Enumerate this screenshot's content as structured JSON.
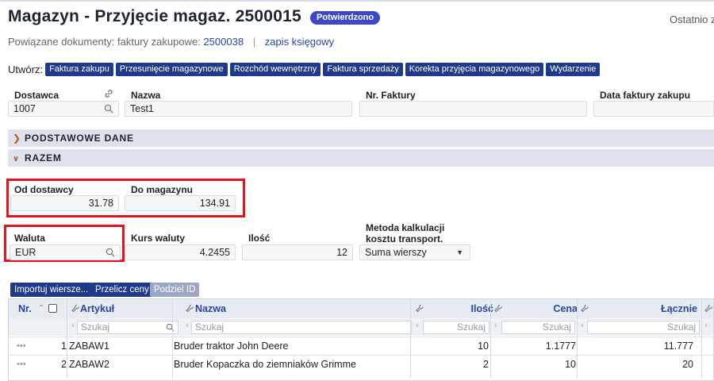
{
  "header": {
    "title": "Magazyn - Przyjęcie magaz. 2500015",
    "status_badge": "Potwierdzono",
    "last_changed": "Ostatnio z"
  },
  "related": {
    "label": "Powiązane dokumenty:",
    "invoices_label": "faktury zakupowe:",
    "invoice_link": "2500038",
    "separator": "|",
    "ledger_link": "zapis księgowy"
  },
  "create": {
    "label": "Utwórz:",
    "buttons": [
      "Faktura zakupu",
      "Przesunięcie magazynowe",
      "Rozchód wewnętrzny",
      "Faktura sprzedaży",
      "Korekta przyjęcia magazynowego",
      "Wydarzenie"
    ]
  },
  "supplier": {
    "supplier_label": "Dostawca",
    "supplier_value": "1007",
    "name_label": "Nazwa",
    "name_value": "Test1",
    "invoice_no_label": "Nr. Faktury",
    "invoice_no_value": "",
    "invoice_date_label": "Data faktury zakupu",
    "invoice_date_value": ""
  },
  "sections": {
    "basic": "PODSTAWOWE DANE",
    "total": "RAZEM"
  },
  "totals": {
    "from_supplier_label": "Od dostawcy",
    "from_supplier_value": "31.78",
    "to_warehouse_label": "Do magazynu",
    "to_warehouse_value": "134.91",
    "currency_label": "Waluta",
    "currency_value": "EUR",
    "rate_label": "Kurs waluty",
    "rate_value": "4.2455",
    "qty_label": "Ilość",
    "qty_value": "12",
    "method_label_1": "Metoda kalkulacji",
    "method_label_2": "kosztu transport.",
    "method_value": "Suma wierszy"
  },
  "actions": {
    "import": "Importuj wiersze...",
    "recalc": "Przelicz ceny",
    "split": "Podziel ID"
  },
  "grid": {
    "headers": {
      "nr": "Nr.",
      "article": "Artykuł",
      "name": "Nazwa",
      "qty": "Ilość",
      "price": "Cena",
      "total": "Łącznie"
    },
    "filter_placeholder": "Szukaj",
    "rows": [
      {
        "nr": "1",
        "article": "ZABAW1",
        "name": "Bruder traktor John Deere",
        "qty": "10",
        "price": "1.1777",
        "total": "11.777"
      },
      {
        "nr": "2",
        "article": "ZABAW2",
        "name": "Bruder Kopaczka do ziemniaków Grimme",
        "qty": "2",
        "price": "10",
        "total": "20"
      }
    ]
  },
  "colors": {
    "accent": "#1f3a8c",
    "badge": "#3d47c9",
    "highlight": "#e3141b",
    "section_bar": "#dde2ec"
  }
}
